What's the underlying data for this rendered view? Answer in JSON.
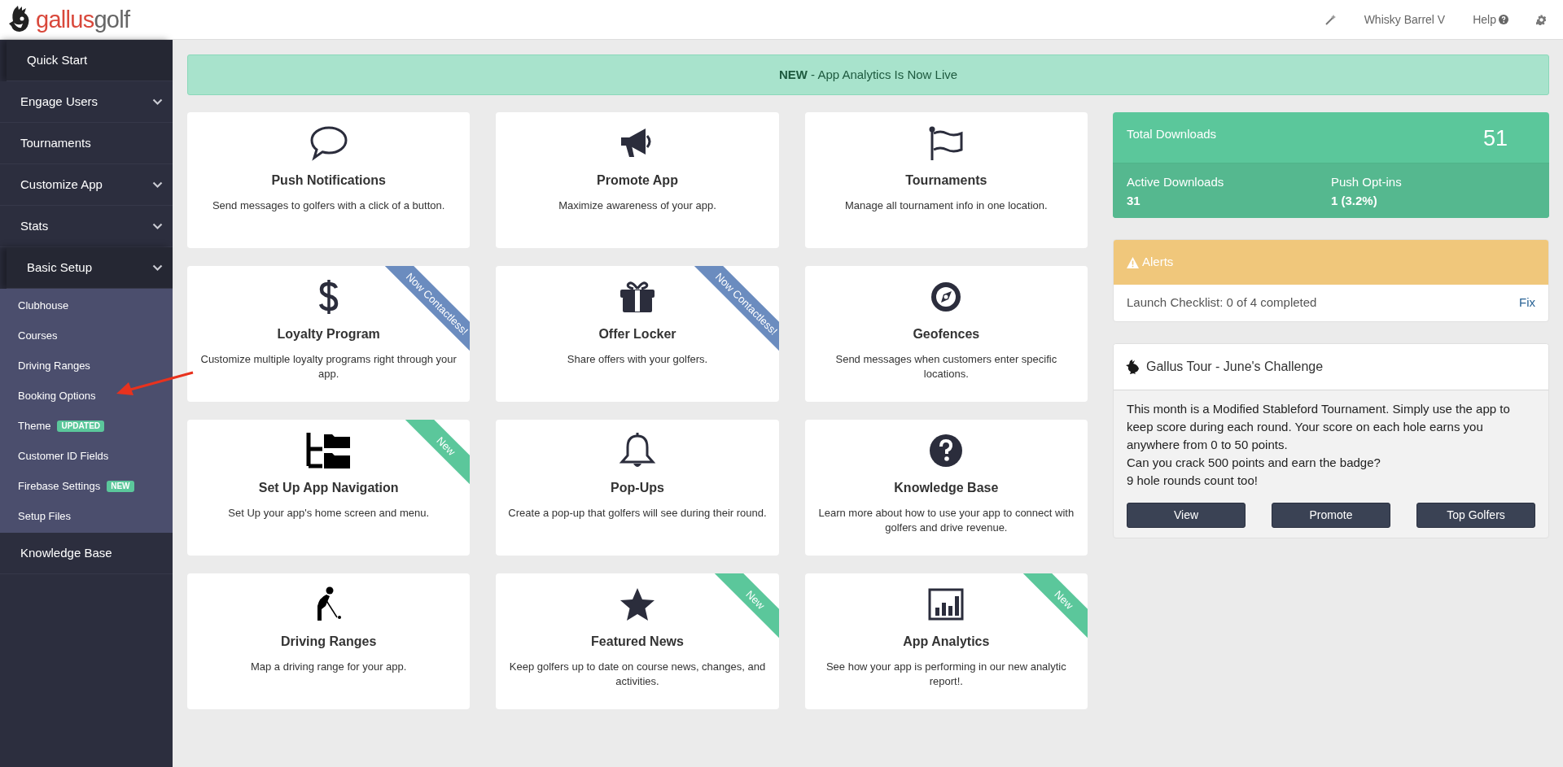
{
  "header": {
    "logo": {
      "part_1": "gallus",
      "part_2": "golf"
    },
    "account": "Whisky Barrel V",
    "help": "Help"
  },
  "sidebar": {
    "items": [
      {
        "label": "Quick Start",
        "kind": "link",
        "selected": true
      },
      {
        "label": "Engage Users",
        "kind": "menu",
        "selected": false
      },
      {
        "label": "Tournaments",
        "kind": "link",
        "selected": false
      },
      {
        "label": "Customize App",
        "kind": "menu",
        "selected": false
      },
      {
        "label": "Stats",
        "kind": "menu",
        "selected": false
      },
      {
        "label": "Basic Setup",
        "kind": "menu",
        "selected": true,
        "children": [
          {
            "label": "Clubhouse"
          },
          {
            "label": "Courses"
          },
          {
            "label": "Driving Ranges"
          },
          {
            "label": "Booking Options"
          },
          {
            "label": "Theme",
            "badge": {
              "text": "UPDATED",
              "color": "#5bc79b"
            }
          },
          {
            "label": "Customer ID Fields"
          },
          {
            "label": "Firebase Settings",
            "badge": {
              "text": "NEW",
              "color": "#5bc79b"
            }
          },
          {
            "label": "Setup Files"
          }
        ]
      },
      {
        "label": "Knowledge Base",
        "kind": "link",
        "selected": false
      }
    ]
  },
  "banner": {
    "bold": "NEW",
    "text": " - App Analytics Is Now Live"
  },
  "cards": [
    {
      "title": "Push Notifications",
      "description": "Send messages to golfers with a click of a button."
    },
    {
      "title": "Promote App",
      "description": "Maximize awareness of your app."
    },
    {
      "title": "Tournaments",
      "description": "Manage all tournament info in one location."
    },
    {
      "title": "Loyalty Program",
      "description": "Customize multiple loyalty programs right through your app.",
      "ribbon": {
        "text": "Now Contactless!",
        "color": "#6b8cbf"
      }
    },
    {
      "title": "Offer Locker",
      "description": "Share offers with your golfers.",
      "ribbon": {
        "text": "Now Contactless!",
        "color": "#6b8cbf"
      }
    },
    {
      "title": "Geofences",
      "description": "Send messages when customers enter specific locations."
    },
    {
      "title": "Set Up App Navigation",
      "description": "Set Up your app's home screen and menu.",
      "ribbon": {
        "text": "New",
        "color": "#5bc79b"
      }
    },
    {
      "title": "Pop-Ups",
      "description": "Create a pop-up that golfers will see during their round."
    },
    {
      "title": "Knowledge Base",
      "description": "Learn more about how to use your app to connect with golfers and drive revenue."
    },
    {
      "title": "Driving Ranges",
      "description": "Map a driving range for your app."
    },
    {
      "title": "Featured News",
      "description": "Keep golfers up to date on course news, changes, and activities.",
      "ribbon": {
        "text": "New",
        "color": "#5bc79b"
      }
    },
    {
      "title": "App Analytics",
      "description": "See how your app is performing in our new analytic report!.",
      "ribbon": {
        "text": "New",
        "color": "#5bc79b"
      }
    }
  ],
  "downloads": {
    "total_label": "Total Downloads",
    "total_value": "51",
    "stats": [
      {
        "label": "Active Downloads",
        "value": "31"
      },
      {
        "label": "Push Opt-ins",
        "value": "1 (3.2%)"
      }
    ]
  },
  "alerts": {
    "title": "Alerts",
    "items": [
      {
        "text": "Launch Checklist: 0 of 4 completed",
        "link": "Fix"
      }
    ]
  },
  "challenge": {
    "title": "Gallus Tour - June's Challenge",
    "lines": [
      "This month is a Modified Stableford Tournament. Simply use the app to keep score during each round. Your score on each hole earns you anywhere from 0 to 50 points.",
      "Can you crack 500 points and earn the badge?",
      "9 hole rounds count too!"
    ],
    "buttons": [
      "View",
      "Promote",
      "Top Golfers"
    ]
  }
}
